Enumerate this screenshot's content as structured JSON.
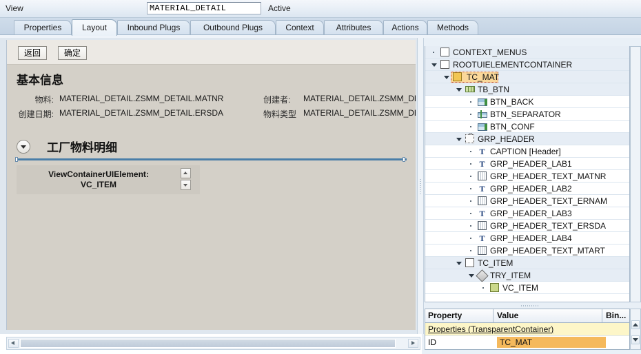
{
  "header": {
    "entity_label": "View",
    "name_value": "MATERIAL_DETAIL",
    "status": "Active"
  },
  "tabs": [
    {
      "label": "Properties",
      "selected": false
    },
    {
      "label": "Layout",
      "selected": true
    },
    {
      "label": "Inbound Plugs",
      "selected": false
    },
    {
      "label": "Outbound Plugs",
      "selected": false
    },
    {
      "label": "Context",
      "selected": false
    },
    {
      "label": "Attributes",
      "selected": false
    },
    {
      "label": "Actions",
      "selected": false
    },
    {
      "label": "Methods",
      "selected": false
    }
  ],
  "editor": {
    "toolbar": {
      "back_label": "返回",
      "confirm_label": "确定"
    },
    "group_header_title": "基本信息",
    "form_rows": [
      {
        "label1": "物料:",
        "value1": "MATERIAL_DETAIL.ZSMM_DETAIL.MATNR",
        "label2": "创建者:",
        "value2": "MATERIAL_DETAIL.ZSMM_DETAIL.ERN"
      },
      {
        "label1": "创建日期:",
        "value1": "MATERIAL_DETAIL.ZSMM_DETAIL.ERSDA",
        "label2": "物料类型",
        "value2": "MATERIAL_DETAIL.ZSMM_DETAIL.MTA"
      }
    ],
    "section": {
      "title": "工厂物料明细",
      "toggle_icon": "chevron-down-icon",
      "view_container_text_line1": "ViewContainerUIElement:",
      "view_container_text_line2": "VC_ITEM"
    }
  },
  "tree": {
    "nodes": [
      {
        "label": "CONTEXT_MENUS",
        "depth": 0,
        "twist": "leaf",
        "icon": "container-icon",
        "shade": true,
        "selected": false
      },
      {
        "label": "ROOTUIELEMENTCONTAINER",
        "depth": 0,
        "twist": "open",
        "icon": "container-icon",
        "shade": true,
        "selected": false
      },
      {
        "label": "TC_MAT",
        "depth": 1,
        "twist": "open",
        "icon": "container-orange-icon",
        "shade": true,
        "selected": true
      },
      {
        "label": "TB_BTN",
        "depth": 2,
        "twist": "open",
        "icon": "toolbar-icon",
        "shade": true,
        "selected": false
      },
      {
        "label": "BTN_BACK",
        "depth": 3,
        "twist": "leaf",
        "icon": "button-icon",
        "shade": false,
        "selected": false
      },
      {
        "label": "BTN_SEPARATOR",
        "depth": 3,
        "twist": "leaf",
        "icon": "button-separator-icon",
        "shade": false,
        "selected": false
      },
      {
        "label": "BTN_CONF",
        "depth": 3,
        "twist": "leaf",
        "icon": "button-icon",
        "shade": false,
        "selected": false
      },
      {
        "label": "GRP_HEADER",
        "depth": 2,
        "twist": "open",
        "icon": "group-icon",
        "shade": true,
        "selected": false
      },
      {
        "label": "CAPTION  [Header]",
        "depth": 3,
        "twist": "leaf",
        "icon": "text-icon",
        "shade": false,
        "selected": false
      },
      {
        "label": "GRP_HEADER_LAB1",
        "depth": 3,
        "twist": "leaf",
        "icon": "text-icon",
        "shade": false,
        "selected": false
      },
      {
        "label": "GRP_HEADER_TEXT_MATNR",
        "depth": 3,
        "twist": "leaf",
        "icon": "textview-icon",
        "shade": false,
        "selected": false
      },
      {
        "label": "GRP_HEADER_LAB2",
        "depth": 3,
        "twist": "leaf",
        "icon": "text-icon",
        "shade": false,
        "selected": false
      },
      {
        "label": "GRP_HEADER_TEXT_ERNAM",
        "depth": 3,
        "twist": "leaf",
        "icon": "textview-icon",
        "shade": false,
        "selected": false
      },
      {
        "label": "GRP_HEADER_LAB3",
        "depth": 3,
        "twist": "leaf",
        "icon": "text-icon",
        "shade": false,
        "selected": false
      },
      {
        "label": "GRP_HEADER_TEXT_ERSDA",
        "depth": 3,
        "twist": "leaf",
        "icon": "textview-icon",
        "shade": false,
        "selected": false
      },
      {
        "label": "GRP_HEADER_LAB4",
        "depth": 3,
        "twist": "leaf",
        "icon": "text-icon",
        "shade": false,
        "selected": false
      },
      {
        "label": "GRP_HEADER_TEXT_MTART",
        "depth": 3,
        "twist": "leaf",
        "icon": "textview-icon",
        "shade": false,
        "selected": false
      },
      {
        "label": "TC_ITEM",
        "depth": 2,
        "twist": "open",
        "icon": "container-icon",
        "shade": true,
        "selected": false
      },
      {
        "label": "TRY_ITEM",
        "depth": 3,
        "twist": "open",
        "icon": "tray-icon",
        "shade": true,
        "selected": false
      },
      {
        "label": "VC_ITEM",
        "depth": 4,
        "twist": "leaf",
        "icon": "viewcontainer-icon",
        "shade": false,
        "selected": false
      }
    ]
  },
  "properties": {
    "columns": [
      "Property",
      "Value",
      "Bin..."
    ],
    "section_row": "Properties (TransparentContainer)",
    "rows": [
      {
        "property": "ID",
        "value": "TC_MAT",
        "highlighted": true
      }
    ]
  },
  "colors": {
    "selection_orange": "#f5b95c",
    "selection_frame": "#c34a2c",
    "section_yellow": "#fdf6c8",
    "section_rule_blue": "#4a7ea8",
    "tree_shade": "#e6edf5"
  }
}
